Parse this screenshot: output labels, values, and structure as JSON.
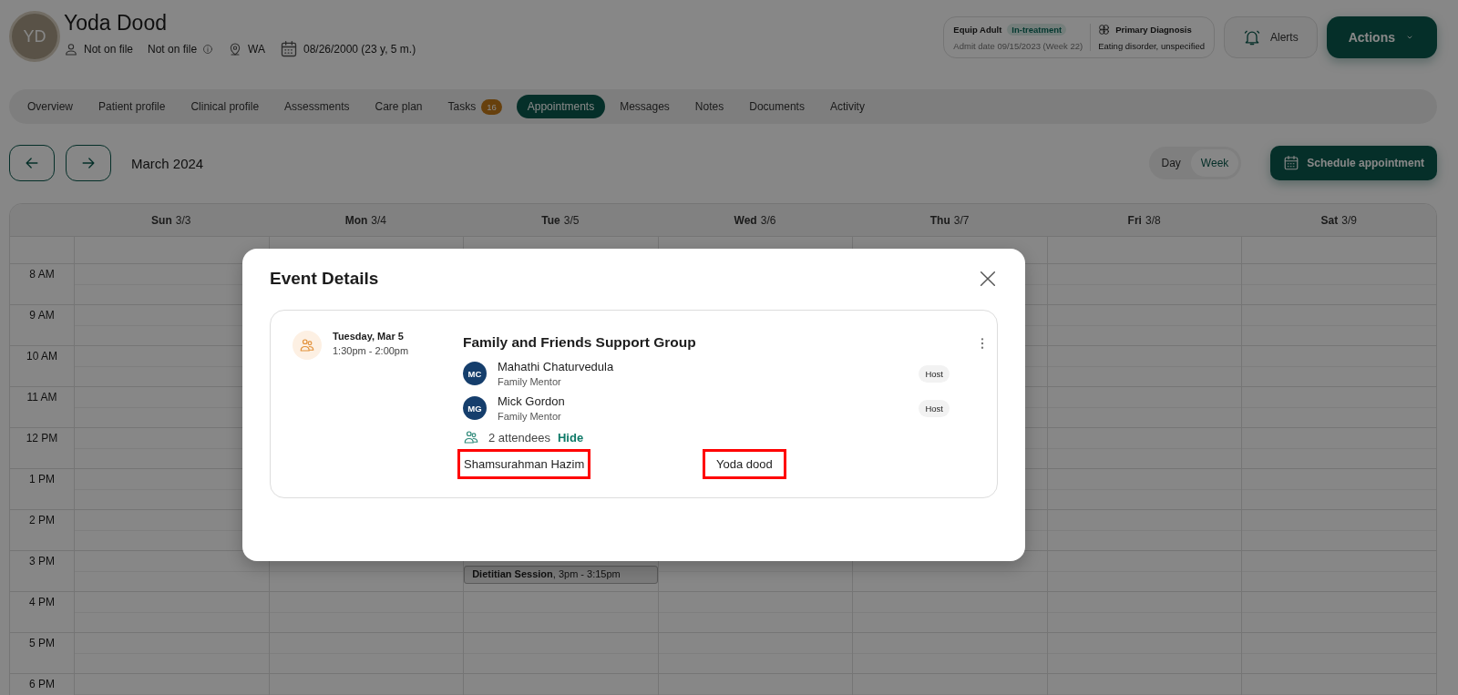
{
  "patient": {
    "initials": "YD",
    "name": "Yoda Dood",
    "meta": [
      {
        "kind": "person",
        "text": "Not on file"
      },
      {
        "kind": "info",
        "text": "Not on file"
      },
      {
        "kind": "location",
        "text": "WA"
      },
      {
        "kind": "calendar",
        "text": "08/26/2000 (23 y, 5 m.)"
      }
    ]
  },
  "program": {
    "name": "Equip Adult",
    "status": "In-treatment",
    "admit": "Admit date 09/15/2023 (Week 22)",
    "diagnosis_label": "Primary Diagnosis",
    "diagnosis": "Eating disorder, unspecified"
  },
  "header_buttons": {
    "alerts": "Alerts",
    "actions": "Actions"
  },
  "tabs": [
    {
      "label": "Overview",
      "selected": false
    },
    {
      "label": "Patient profile",
      "selected": false
    },
    {
      "label": "Clinical profile",
      "selected": false
    },
    {
      "label": "Assessments",
      "selected": false
    },
    {
      "label": "Care plan",
      "selected": false
    },
    {
      "label": "Tasks",
      "badge": "16",
      "selected": false
    },
    {
      "label": "Appointments",
      "selected": true
    },
    {
      "label": "Messages",
      "selected": false
    },
    {
      "label": "Notes",
      "selected": false
    },
    {
      "label": "Documents",
      "selected": false
    },
    {
      "label": "Activity",
      "selected": false
    }
  ],
  "calendar": {
    "month": "March 2024",
    "views": [
      {
        "label": "Day",
        "selected": false
      },
      {
        "label": "Week",
        "selected": true
      }
    ],
    "schedule_button": "Schedule appointment",
    "days": [
      {
        "name": "Sun",
        "date": "3/3"
      },
      {
        "name": "Mon",
        "date": "3/4"
      },
      {
        "name": "Tue",
        "date": "3/5"
      },
      {
        "name": "Wed",
        "date": "3/6"
      },
      {
        "name": "Thu",
        "date": "3/7"
      },
      {
        "name": "Fri",
        "date": "3/8"
      },
      {
        "name": "Sat",
        "date": "3/9"
      }
    ],
    "rows": [
      {
        "time": "8 AM"
      },
      {
        "time": "9 AM"
      },
      {
        "time": "10 AM"
      },
      {
        "time": "11 AM"
      },
      {
        "time": "12 PM"
      },
      {
        "time": "1 PM"
      },
      {
        "time": "2 PM"
      },
      {
        "time": "3 PM",
        "cells": [
          {},
          {},
          {
            "event": "**Dietitian Session**, 3pm - 3:15pm"
          },
          {},
          {},
          {},
          {}
        ]
      },
      {
        "time": "4 PM"
      },
      {
        "time": "5 PM"
      },
      {
        "time": "6 PM"
      }
    ]
  },
  "modal": {
    "title": "Event Details",
    "date": "Tuesday, Mar 5",
    "time": "1:30pm - 2:00pm",
    "event_title": "Family and Friends Support Group",
    "hosts": [
      {
        "initials": "MC",
        "name": "Mahathi Chaturvedula",
        "role": "Family Mentor",
        "badge": "Host"
      },
      {
        "initials": "MG",
        "name": "Mick Gordon",
        "role": "Family Mentor",
        "badge": "Host"
      }
    ],
    "attendee_count": "2 attendees",
    "toggle": "Hide",
    "attendees": [
      {
        "name": "Shamsurahman Hazim",
        "highlighted": true
      },
      {
        "name": "Yoda dood",
        "highlighted": true
      }
    ]
  }
}
